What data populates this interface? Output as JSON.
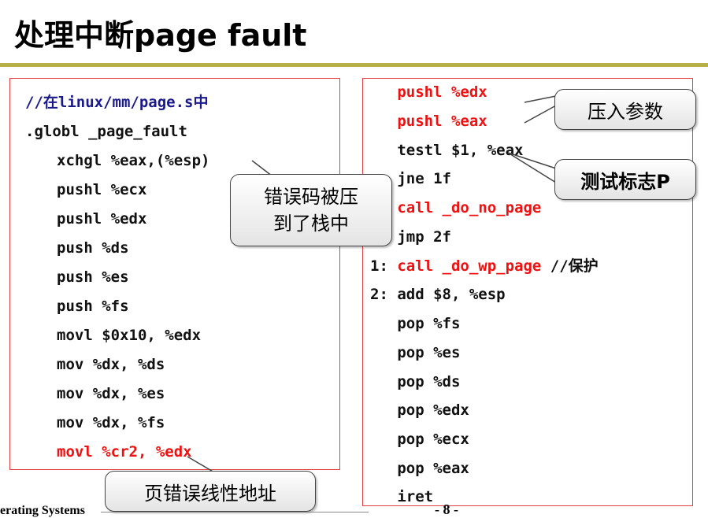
{
  "slide": {
    "title": "处理中断page fault",
    "footer_left": "erating Systems",
    "page_number": "- 8 -"
  },
  "left_code": [
    {
      "text": "//在linux/mm/page.s中",
      "style": "comment"
    },
    {
      "text": ".globl _page_fault",
      "style": "normal"
    },
    {
      "text": "xchgl %eax,(%esp)",
      "style": "normal"
    },
    {
      "text": "pushl %ecx",
      "style": "normal"
    },
    {
      "text": "pushl %edx",
      "style": "normal"
    },
    {
      "text": "push %ds",
      "style": "normal"
    },
    {
      "text": "push %es",
      "style": "normal"
    },
    {
      "text": "push %fs",
      "style": "normal"
    },
    {
      "text": "movl $0x10, %edx",
      "style": "normal"
    },
    {
      "text": "mov %dx, %ds",
      "style": "normal"
    },
    {
      "text": "mov %dx, %es",
      "style": "normal"
    },
    {
      "text": "mov %dx, %fs",
      "style": "normal"
    },
    {
      "text": "movl %cr2, %edx",
      "style": "red"
    }
  ],
  "right_code": [
    {
      "label": "",
      "text": "pushl %edx",
      "style": "red"
    },
    {
      "label": "",
      "text": "pushl %eax",
      "style": "red"
    },
    {
      "label": "",
      "text": "testl $1, %eax",
      "style": "normal"
    },
    {
      "label": "",
      "text": "jne 1f",
      "style": "normal"
    },
    {
      "label": "",
      "text": "call _do_no_page",
      "style": "red"
    },
    {
      "label": "",
      "text": "jmp 2f",
      "style": "normal"
    },
    {
      "label": "1:",
      "text": "call _do_wp_page",
      "style": "red",
      "comment": "//保护"
    },
    {
      "label": "2:",
      "text": "add $8, %esp",
      "style": "normal"
    },
    {
      "label": "",
      "text": "pop %fs",
      "style": "normal"
    },
    {
      "label": "",
      "text": "pop %es",
      "style": "normal"
    },
    {
      "label": "",
      "text": "pop %ds",
      "style": "normal"
    },
    {
      "label": "",
      "text": "pop %edx",
      "style": "normal"
    },
    {
      "label": "",
      "text": "pop %ecx",
      "style": "normal"
    },
    {
      "label": "",
      "text": "pop %eax",
      "style": "normal"
    },
    {
      "label": "",
      "text": "iret",
      "style": "normal"
    }
  ],
  "callouts": {
    "error_code": "错误码被压\n到了栈中",
    "page_fault_addr": "页错误线性地址",
    "push_params": "压入参数",
    "test_flag": "测试标志P"
  },
  "colors": {
    "accent_red": "#ee1111",
    "rule": "#b7b04a",
    "comment_blue": "#1a1a8c"
  }
}
